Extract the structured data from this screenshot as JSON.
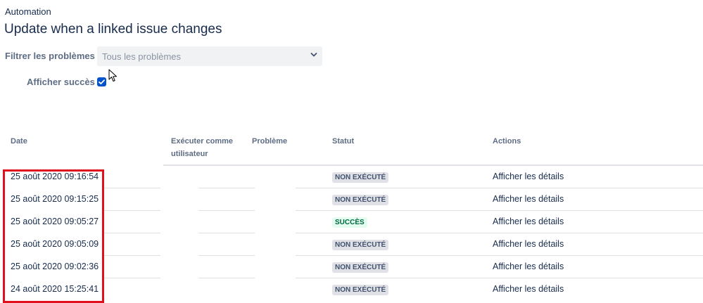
{
  "breadcrumb": "Automation",
  "title": "Update when a linked issue changes",
  "filter": {
    "label": "Filtrer les problèmes",
    "selected": "Tous les problèmes"
  },
  "show_success": {
    "label": "Afficher succès",
    "checked": true
  },
  "table": {
    "headers": {
      "date": "Date",
      "run_as": "Exécuter comme utilisateur",
      "issue": "Problème",
      "status": "Statut",
      "actions": "Actions"
    },
    "rows": [
      {
        "date": "25 août 2020 09:16:54",
        "status": "NON EXÉCUTÉ",
        "status_kind": "neutral",
        "action": "Afficher les détails"
      },
      {
        "date": "25 août 2020 09:15:25",
        "status": "NON EXÉCUTÉ",
        "status_kind": "neutral",
        "action": "Afficher les détails"
      },
      {
        "date": "25 août 2020 09:05:27",
        "status": "SUCCÈS",
        "status_kind": "success",
        "action": "Afficher les détails"
      },
      {
        "date": "25 août 2020 09:05:09",
        "status": "NON EXÉCUTÉ",
        "status_kind": "neutral",
        "action": "Afficher les détails"
      },
      {
        "date": "25 août 2020 09:02:36",
        "status": "NON EXÉCUTÉ",
        "status_kind": "neutral",
        "action": "Afficher les détails"
      },
      {
        "date": "24 août 2020 15:25:41",
        "status": "NON EXÉCUTÉ",
        "status_kind": "neutral",
        "action": "Afficher les détails"
      }
    ]
  },
  "colors": {
    "text": "#172b4d",
    "label": "#5e6c84",
    "accent": "#0052cc",
    "highlight": "#e0101f"
  }
}
